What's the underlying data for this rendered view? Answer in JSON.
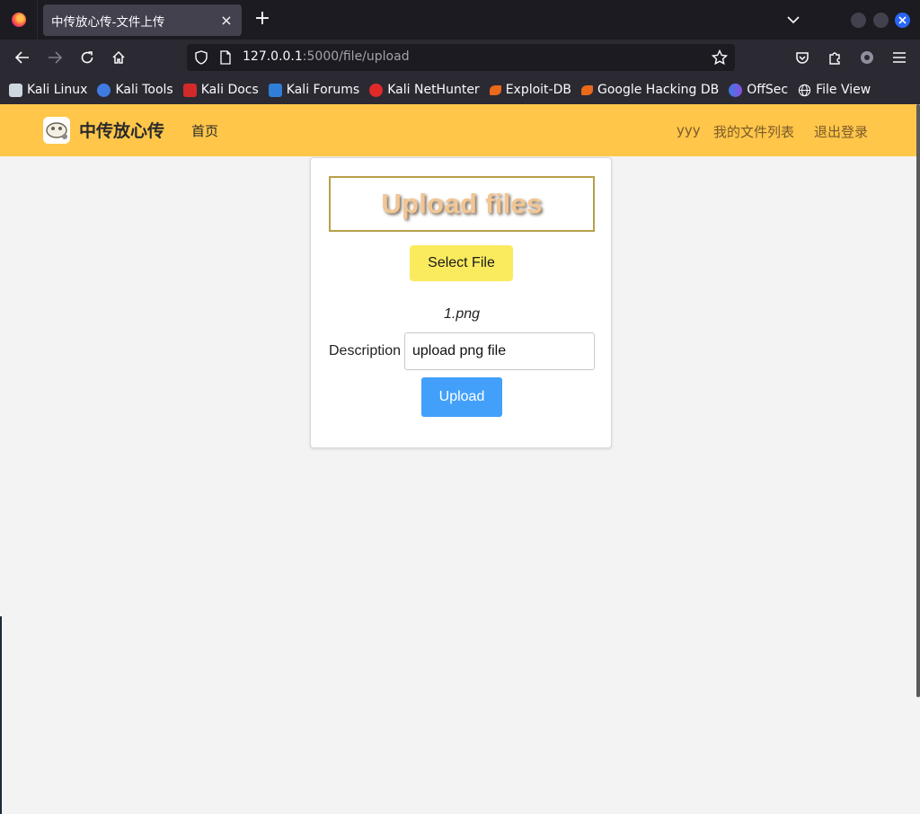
{
  "browser": {
    "tab": {
      "title": "中传放心传-文件上传",
      "close": "×"
    },
    "new_tab": "+",
    "url": {
      "host": "127.0.0.1",
      "path": ":5000/file/upload"
    },
    "bookmarks": [
      {
        "label": "Kali Linux",
        "icon": "kali-dragon-icon",
        "color": "#cfd6e0"
      },
      {
        "label": "Kali Tools",
        "icon": "kali-tools-icon",
        "color": "#3f7be0"
      },
      {
        "label": "Kali Docs",
        "icon": "kali-docs-icon",
        "color": "#d22a2a"
      },
      {
        "label": "Kali Forums",
        "icon": "kali-forums-icon",
        "color": "#2f7ed8"
      },
      {
        "label": "Kali NetHunter",
        "icon": "kali-nethunter-icon",
        "color": "#e02a2a"
      },
      {
        "label": "Exploit-DB",
        "icon": "exploit-db-icon",
        "color": "#e86a1a"
      },
      {
        "label": "Google Hacking DB",
        "icon": "ghdb-icon",
        "color": "#e86a1a"
      },
      {
        "label": "OffSec",
        "icon": "offsec-icon",
        "color": "#6b5ce0"
      },
      {
        "label": "File View",
        "icon": "globe-icon",
        "color": "#fbfbfe"
      }
    ]
  },
  "site": {
    "name": "中传放心传",
    "nav_home": "首页",
    "user": "yyy",
    "my_files": "我的文件列表",
    "logout": "退出登录",
    "header_color": "#ffc64a"
  },
  "upload": {
    "title": "Upload files",
    "select_label": "Select File",
    "file_name": "1.png",
    "description_label": "Description",
    "description_value": "upload png file",
    "upload_label": "Upload",
    "accent": "#42a0fa",
    "select_color": "#faeb5e"
  }
}
